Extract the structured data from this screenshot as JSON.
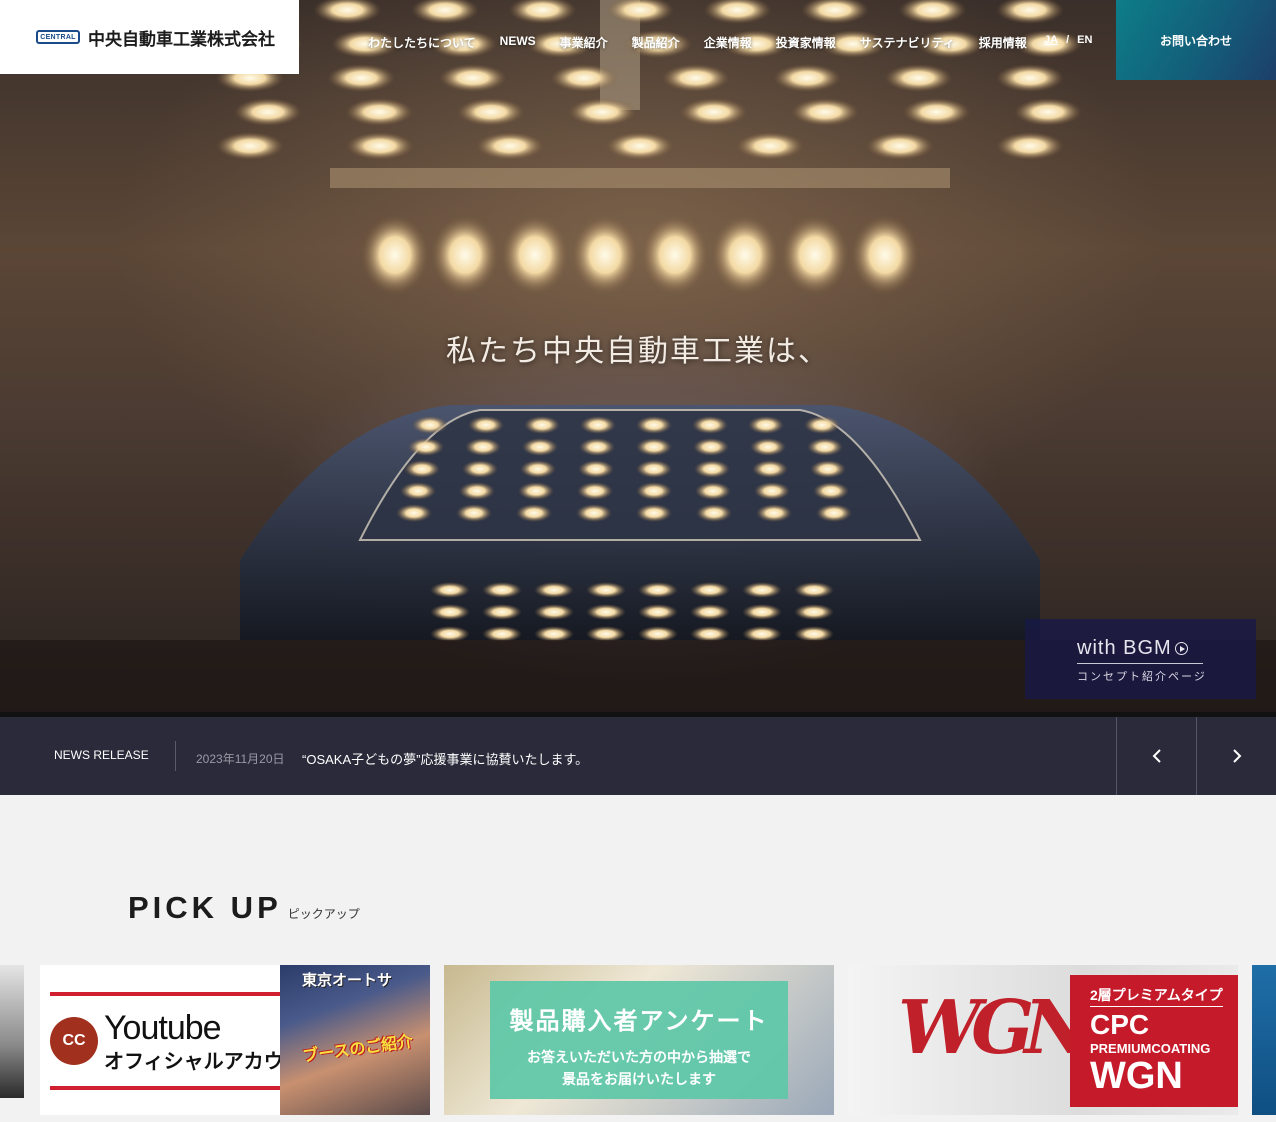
{
  "header": {
    "logo_badge": "CENTRAL",
    "company_name": "中央自動車工業株式会社",
    "nav": [
      "わたしたちについて",
      "NEWS",
      "事業紹介",
      "製品紹介",
      "企業情報",
      "投資家情報",
      "サステナビリティ",
      "採用情報"
    ],
    "lang_ja": "JA",
    "lang_sep": "/",
    "lang_en": "EN",
    "contact": "お問い合わせ"
  },
  "hero": {
    "caption": "私たち中央自動車工業は、",
    "bgm_title": "with BGM",
    "bgm_sub": "コンセプト紹介ページ"
  },
  "news": {
    "label": "NEWS RELEASE",
    "date": "2023年11月20日",
    "title": "“OSAKA子どもの夢”応援事業に協賛いたします。",
    "prev_icon": "chevron-left-icon",
    "next_icon": "chevron-right-icon"
  },
  "pickup": {
    "title_en": "PICK UP",
    "title_ja": "ピックアップ",
    "cards": [
      {
        "title": "Youtube",
        "subtitle": "オフィシャルアカウント",
        "logo_text": "CC",
        "photo_top": "東京オートサ",
        "photo_text": "ブースのご紹介"
      },
      {
        "title": "製品購入者アンケート",
        "text_line1": "お答えいただいた方の中から抽選で",
        "text_line2": "景品をお届けいたします"
      },
      {
        "logo": "WGN",
        "small": "2層プレミアムタイプ",
        "cpc": "CPC",
        "premium": "PREMIUMCOATING",
        "big": "WGN"
      }
    ]
  },
  "colors": {
    "accent_teal": "#0d7d88",
    "news_bg": "#2b2a3a",
    "wgn_red": "#c51a2a",
    "survey_green": "#60c8a8"
  }
}
